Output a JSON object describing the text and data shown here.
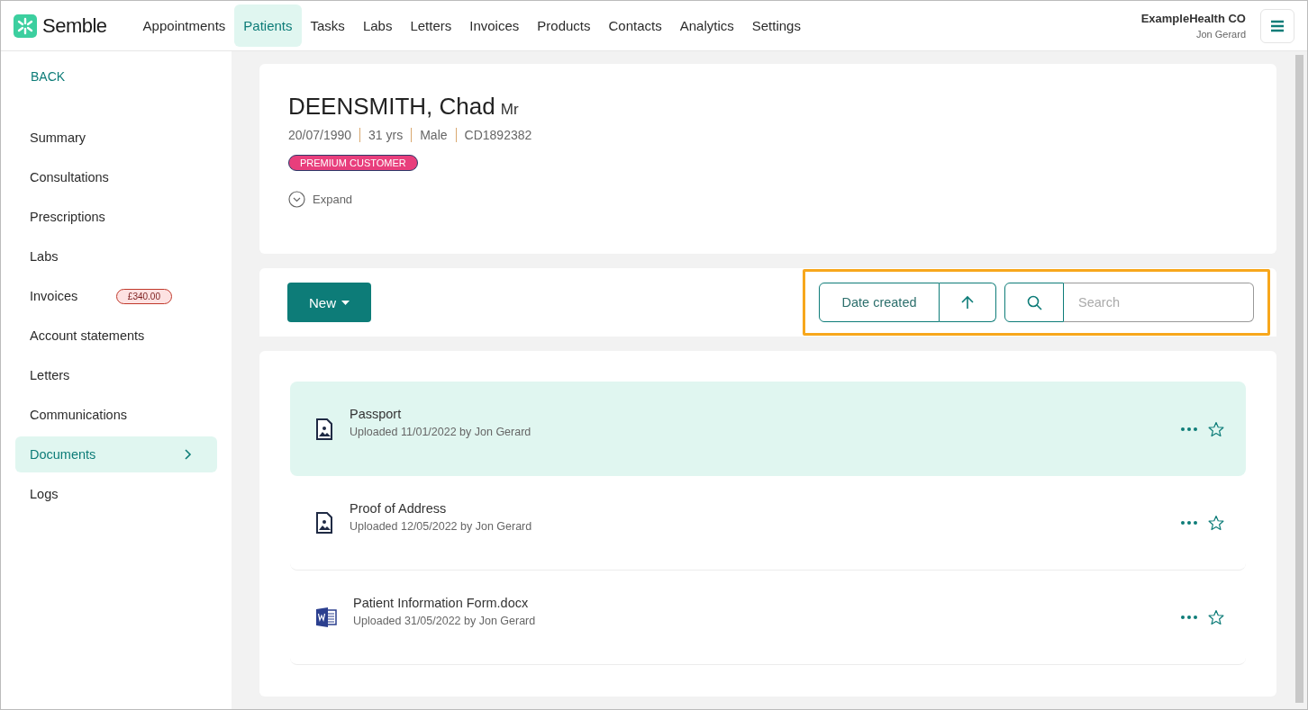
{
  "brand": {
    "name": "Semble"
  },
  "nav": [
    {
      "label": "Appointments",
      "selected": false
    },
    {
      "label": "Patients",
      "selected": true
    },
    {
      "label": "Tasks",
      "selected": false
    },
    {
      "label": "Labs",
      "selected": false
    },
    {
      "label": "Letters",
      "selected": false
    },
    {
      "label": "Invoices",
      "selected": false
    },
    {
      "label": "Products",
      "selected": false
    },
    {
      "label": "Contacts",
      "selected": false
    },
    {
      "label": "Analytics",
      "selected": false
    },
    {
      "label": "Settings",
      "selected": false
    }
  ],
  "account": {
    "organisation": "ExampleHealth CO",
    "user": "Jon Gerard"
  },
  "sidebar": {
    "back": "BACK",
    "items": [
      {
        "label": "Summary",
        "selected": false
      },
      {
        "label": "Consultations",
        "selected": false
      },
      {
        "label": "Prescriptions",
        "selected": false
      },
      {
        "label": "Labs",
        "selected": false
      },
      {
        "label": "Invoices",
        "selected": false,
        "badge": "£340.00"
      },
      {
        "label": "Account statements",
        "selected": false
      },
      {
        "label": "Letters",
        "selected": false
      },
      {
        "label": "Communications",
        "selected": false
      },
      {
        "label": "Documents",
        "selected": true
      },
      {
        "label": "Logs",
        "selected": false
      }
    ]
  },
  "patient": {
    "name": "DEENSMITH, Chad",
    "title": "Mr",
    "details": [
      "20/07/1990",
      "31 yrs",
      "Male",
      "CD1892382"
    ],
    "tag": "PREMIUM CUSTOMER",
    "expand": "Expand"
  },
  "toolbar": {
    "new_button": "New",
    "sort": "Date created",
    "search": {
      "placeholder": "Search"
    }
  },
  "documents": [
    {
      "kind": "image",
      "name": "Passport",
      "meta": "Uploaded 11/01/2022 by Jon Gerard",
      "selected": true
    },
    {
      "kind": "image",
      "name": "Proof of Address",
      "meta": "Uploaded 12/05/2022 by Jon Gerard",
      "selected": false
    },
    {
      "kind": "word",
      "name": "Patient Information Form.docx",
      "meta": "Uploaded 31/05/2022 by Jon Gerard",
      "selected": false
    }
  ]
}
